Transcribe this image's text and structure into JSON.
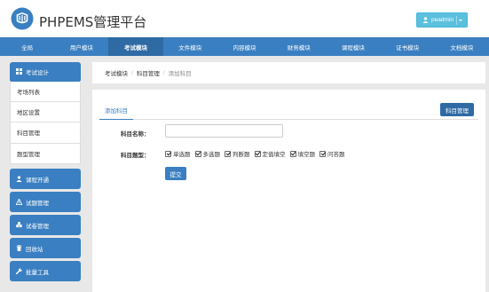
{
  "header": {
    "brand": "PHPEMS管理平台",
    "user_label": "peadmin"
  },
  "topnav": {
    "items": [
      "全局",
      "用户模块",
      "考试模块",
      "文件模块",
      "内容模块",
      "财务模块",
      "课程模块",
      "证书模块",
      "文档模块"
    ],
    "active_index": 2
  },
  "sidebar": {
    "section_title": "考试设计",
    "sub_items": [
      "考场列表",
      "地区设置",
      "科目管理",
      "题型管理"
    ],
    "groups": [
      "课程开通",
      "试题管理",
      "试卷管理",
      "回收站",
      "批量工具"
    ]
  },
  "breadcrumb": {
    "items": [
      "考试模块",
      "科目管理"
    ],
    "current": "添加科目",
    "separator": "/"
  },
  "panel": {
    "tab_label": "添加科目",
    "manage_button": "科目管理",
    "name_label": "科目名称：",
    "name_value": "",
    "type_label": "科目题型：",
    "question_types": [
      {
        "label": "单选题",
        "checked": true
      },
      {
        "label": "多选题",
        "checked": true
      },
      {
        "label": "判断题",
        "checked": true
      },
      {
        "label": "定值填空",
        "checked": true
      },
      {
        "label": "填空题",
        "checked": true
      },
      {
        "label": "问答题",
        "checked": true
      }
    ],
    "submit_label": "提交"
  },
  "colors": {
    "primary": "#3a7fc1",
    "primary_dark": "#2e6aa4",
    "user_button": "#5bc0de",
    "background": "#e8e8e8"
  }
}
